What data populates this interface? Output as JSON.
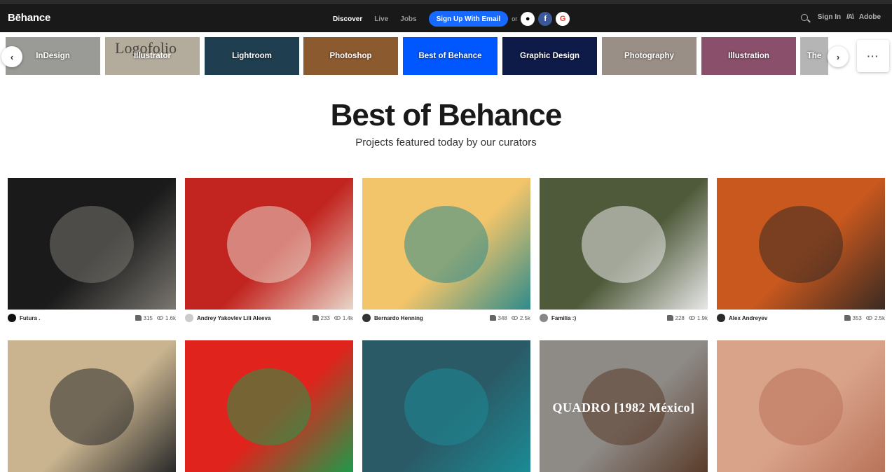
{
  "header": {
    "logo": "Bēhance",
    "nav_links": [
      "Discover",
      "Live",
      "Jobs"
    ],
    "signup_label": "Sign Up With Email",
    "or_text": "or",
    "social_icons": [
      "apple-icon",
      "facebook-icon",
      "google-icon"
    ],
    "signin_label": "Sign In",
    "adobe_label": "Adobe"
  },
  "categories": [
    {
      "label": "InDesign",
      "color": "#9a9a96"
    },
    {
      "label": "Illustrator",
      "color": "#b3ab9c",
      "overlay": "Logofolio"
    },
    {
      "label": "Lightroom",
      "color": "#1f3e4f"
    },
    {
      "label": "Photoshop",
      "color": "#8c5a2f"
    },
    {
      "label": "Best of Behance",
      "color": "#0057ff"
    },
    {
      "label": "Graphic Design",
      "color": "#0e1a48"
    },
    {
      "label": "Photography",
      "color": "#9a8f86"
    },
    {
      "label": "Illustration",
      "color": "#8a4f6b"
    },
    {
      "label": "The",
      "color": "#b5b5b5"
    }
  ],
  "page": {
    "title": "Best of Behance",
    "subtitle": "Projects featured today by our curators"
  },
  "projects": [
    {
      "owner": "Futura .",
      "likes": "315",
      "views": "1.6k",
      "color": "#1a1a1a",
      "accent": "#7a7670",
      "avatar": "#111111"
    },
    {
      "owner": "Andrey Yakovlev Lili Aleeva",
      "likes": "233",
      "views": "1.4k",
      "color": "#c2241f",
      "accent": "#e9d6c9",
      "avatar": "#cccccc"
    },
    {
      "owner": "Bernardo Henning",
      "likes": "348",
      "views": "2.5k",
      "color": "#f3c56a",
      "accent": "#2e8b8b",
      "avatar": "#333333"
    },
    {
      "owner": "Familia :)",
      "likes": "228",
      "views": "1.9k",
      "color": "#4f5a3a",
      "accent": "#e8e8e8",
      "avatar": "#888888"
    },
    {
      "owner": "Alex Andreyev",
      "likes": "353",
      "views": "2.5k",
      "color": "#c8581e",
      "accent": "#3a2a22",
      "avatar": "#2a2a2a"
    },
    {
      "color": "#c9b48f",
      "accent": "#2a2a2a"
    },
    {
      "color": "#e0231c",
      "accent": "#1f9a4a"
    },
    {
      "color": "#2a5a66",
      "accent": "#1b8b95"
    },
    {
      "color": "#8e8a86",
      "accent": "#5a3b2a",
      "overlay": "QUADRO [1982 México]"
    },
    {
      "color": "#d9a38a",
      "accent": "#b9735a"
    }
  ]
}
